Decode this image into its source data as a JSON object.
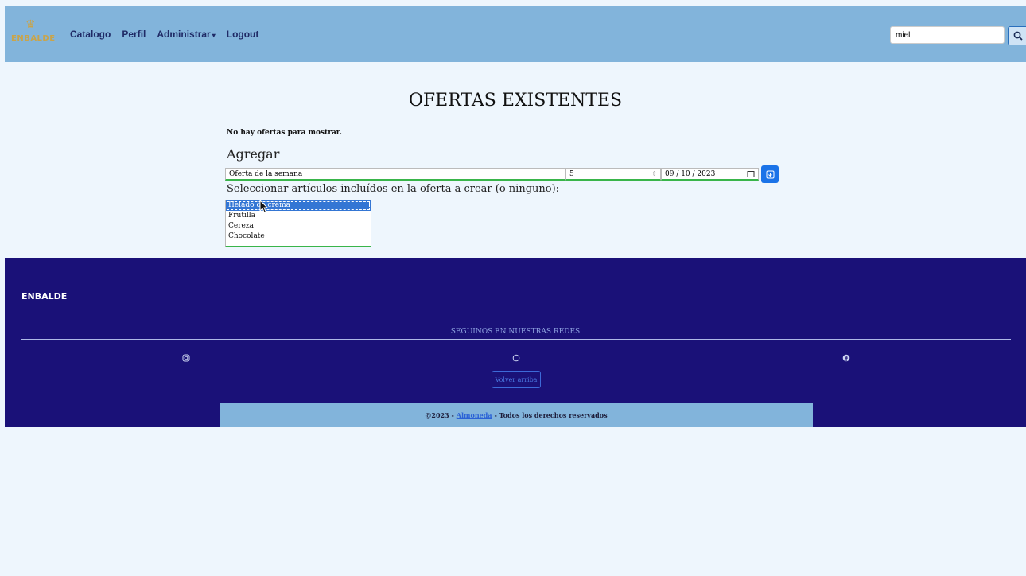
{
  "navbar": {
    "logo_text": "ENBALDE",
    "links": [
      "Catalogo",
      "Perfil",
      "Administrar",
      "Logout"
    ],
    "search_value": "miel"
  },
  "main": {
    "title": "OFERTAS EXISTENTES",
    "empty_message": "No hay ofertas para mostrar.",
    "add_heading": "Agregar",
    "form": {
      "name_value": "Oferta de la semana",
      "discount_value": "5",
      "date_value": "09 / 10 / 2023"
    },
    "select_label": "Seleccionar artículos incluídos en la oferta a crear (o ninguno):",
    "options": [
      "Helado de crema",
      "Frutilla",
      "Cereza",
      "Chocolate"
    ],
    "selected_option": "Helado de crema"
  },
  "footer": {
    "brand": "ENBALDE",
    "follow_text": "SEGUINOS EN NUESTRAS REDES",
    "back_to_top": "Volver arriba",
    "copyright_prefix": "@2023 -",
    "copyright_link": "Almoneda",
    "copyright_suffix": "- Todos los derechos reservados"
  },
  "colors": {
    "navbar": "#82b4db",
    "footer": "#1a1178",
    "accent_blue": "#1a73e8",
    "focus_green": "#39b54a"
  },
  "icons": [
    "search-icon",
    "save-icon",
    "instagram-icon",
    "whatsapp-icon",
    "facebook-icon",
    "chevron-down-icon"
  ]
}
